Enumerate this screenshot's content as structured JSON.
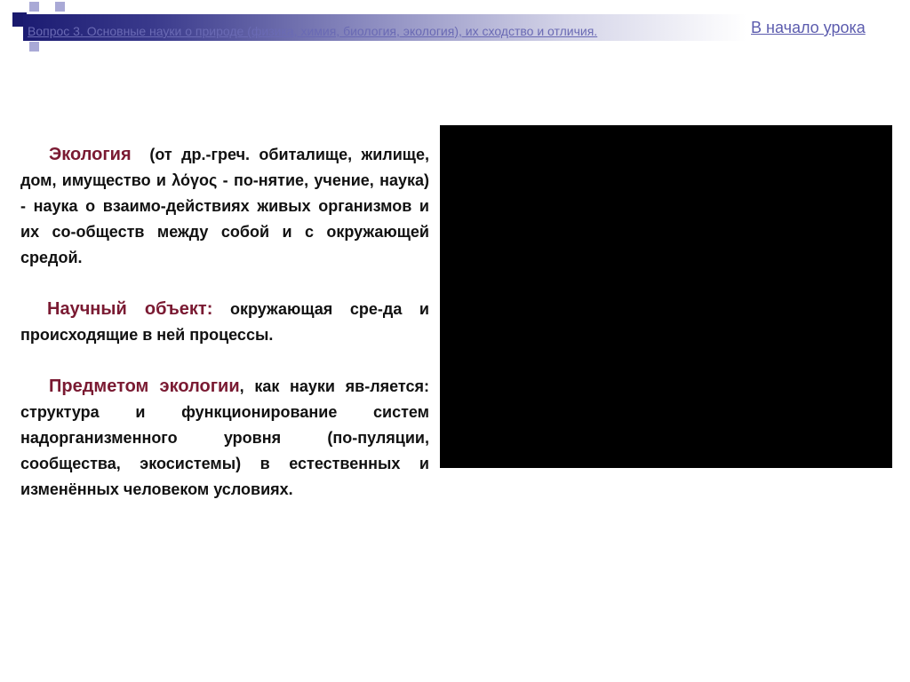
{
  "header": {
    "title": "Вопрос 3. Основные науки о природе (физика, химия, биология, экология), их сходство и отличия.",
    "back_link": "В начало урока"
  },
  "content": {
    "p1": {
      "term": "Экология",
      "text": "(от др.-греч. обиталище, жилище, дом, имущество и λόγος - по-нятие, учение, наука) - наука о взаимо-действиях живых организмов и их со-обществ между собой и с окружающей средой."
    },
    "p2": {
      "term": "Научный объект:",
      "text": "окружающая сре-да и происходящие в ней процессы."
    },
    "p3": {
      "term": "Предметом экологии",
      "text": ", как науки яв-ляется: структура и функционирование систем надорганизменного уровня (по-пуляции, сообщества, экосистемы) в естественных и изменённых человеком условиях."
    }
  },
  "colors": {
    "header_dark": "#1c1c72",
    "link": "#5c5cae",
    "term": "#7a1a32",
    "media_box": "#000000"
  }
}
